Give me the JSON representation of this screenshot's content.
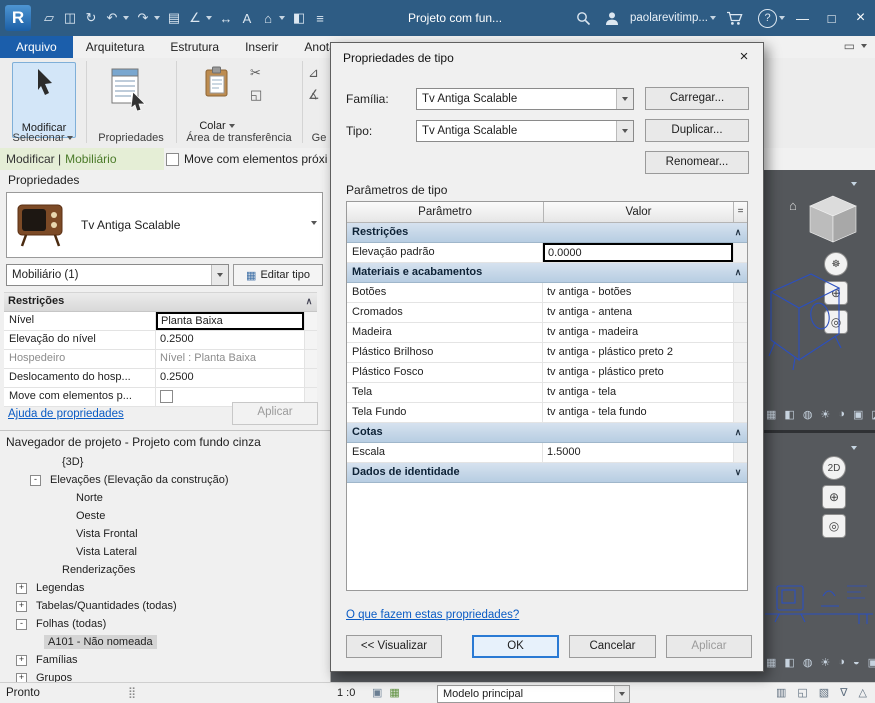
{
  "colors": {
    "titlebar": "#2e5c84",
    "file_tab": "#1b5eab",
    "section_header": "#b7cde2",
    "link": "#0a5bc4",
    "context_green": "#4a7a28",
    "viewport_bg": "#54575b",
    "wireframe_blue": "#2b4fc0"
  },
  "title_bar": {
    "app_button": "R",
    "qat": [
      {
        "name": "open-icon",
        "glyph": "▱"
      },
      {
        "name": "save-icon",
        "glyph": "◫"
      },
      {
        "name": "sync-icon",
        "glyph": "↻"
      },
      {
        "name": "undo-icon",
        "glyph": "↶",
        "caret": true
      },
      {
        "name": "redo-icon",
        "glyph": "↷",
        "caret": true
      },
      {
        "name": "print-icon",
        "glyph": "▤"
      },
      {
        "name": "measure-icon",
        "glyph": "∠",
        "caret": true
      },
      {
        "name": "aligned-dimension-icon",
        "glyph": "↔"
      },
      {
        "name": "text-icon",
        "glyph": "A"
      },
      {
        "name": "default-3d-view-icon",
        "glyph": "⌂",
        "caret": true
      },
      {
        "name": "section-icon",
        "glyph": "◧"
      },
      {
        "name": "thin-lines-icon",
        "glyph": "≡"
      }
    ],
    "project_title": "Projeto com fun...",
    "user_name": "paolarevitimp...",
    "help_glyph": "?",
    "window_controls": {
      "minimize": "—",
      "maximize": "□",
      "close": "×"
    }
  },
  "ribbon": {
    "tabs": [
      {
        "label": "Arquivo",
        "type": "file"
      },
      {
        "label": "Arquitetura"
      },
      {
        "label": "Estrutura"
      },
      {
        "label": "Inserir"
      },
      {
        "label": "Anotar"
      }
    ],
    "corner_icons": [
      {
        "name": "ribbon-display-icon",
        "glyph": "▭"
      }
    ],
    "modify_label": "Modificar",
    "select_panel_label": "Selecionar",
    "properties_panel_label": "Propriedades",
    "paste_label": "Colar",
    "clipboard_panel_label": "Área de transferência",
    "geometry_panel_label": "Ge",
    "clipboard_icons": [
      {
        "name": "cut-icon",
        "glyph": "✂"
      },
      {
        "name": "copy-icon",
        "glyph": "◱"
      }
    ],
    "geometry_icons": [
      {
        "name": "join-geometry-icon",
        "glyph": "⊿"
      },
      {
        "name": "cope-icon",
        "glyph": "∡"
      }
    ]
  },
  "options_bar": {
    "context_prefix": "Modificar |",
    "context_name": "Mobiliário",
    "checkbox_label": "Move com elementos próxim"
  },
  "properties_palette": {
    "title": "Propriedades",
    "type_name": "Tv Antiga Scalable",
    "selector_value": "Mobiliário (1)",
    "edit_type_icon": "▦",
    "edit_type_button": "Editar tipo",
    "rows": [
      {
        "kind": "section",
        "label": "Restrições"
      },
      {
        "kind": "focused",
        "label": "Nível",
        "value": "Planta Baixa"
      },
      {
        "kind": "text",
        "label": "Elevação do nível",
        "value": "0.2500"
      },
      {
        "kind": "readonly",
        "label": "Hospedeiro",
        "value": "Nível : Planta Baixa"
      },
      {
        "kind": "text",
        "label": "Deslocamento do hosp...",
        "value": "0.2500"
      },
      {
        "kind": "checkbox",
        "label": "Move com elementos p...",
        "checked": false
      }
    ],
    "help_link": "Ajuda de propriedades",
    "apply_button": "Aplicar"
  },
  "project_browser": {
    "title": "Navegador de projeto - Projeto com fundo cinza",
    "items": [
      {
        "label": "{3D}",
        "level": 4
      },
      {
        "label": "Elevações (Elevação da construção)",
        "level": 2,
        "expander": "-"
      },
      {
        "label": "Norte",
        "level": 5
      },
      {
        "label": "Oeste",
        "level": 5
      },
      {
        "label": "Vista Frontal",
        "level": 5
      },
      {
        "label": "Vista Lateral",
        "level": 5
      },
      {
        "label": "Renderizações",
        "level": 4
      },
      {
        "label": "Legendas",
        "level": 1,
        "expander": "+"
      },
      {
        "label": "Tabelas/Quantidades (todas)",
        "level": 1,
        "expander": "+"
      },
      {
        "label": "Folhas (todas)",
        "level": 1,
        "expander": "-"
      },
      {
        "label": "A101 - Não nomeada",
        "level": 3,
        "selected": true
      },
      {
        "label": "Famílias",
        "level": 1,
        "expander": "+"
      },
      {
        "label": "Grupos",
        "level": 1,
        "expander": "+"
      }
    ]
  },
  "dialog": {
    "title": "Propriedades de tipo",
    "family_label": "Família:",
    "family_value": "Tv Antiga Scalable",
    "load_button": "Carregar...",
    "type_label": "Tipo:",
    "type_value": "Tv Antiga Scalable",
    "duplicate_button": "Duplicar...",
    "rename_button": "Renomear...",
    "parameters_label": "Parâmetros de tipo",
    "table": {
      "param_header": "Parâmetro",
      "value_header": "Valor",
      "eq_header": "=",
      "rows": [
        {
          "type": "section",
          "label": "Restrições",
          "chevron": "up"
        },
        {
          "type": "value",
          "label": "Elevação padrão",
          "value": "0.0000",
          "focused": true
        },
        {
          "type": "section",
          "label": "Materiais e acabamentos",
          "chevron": "up"
        },
        {
          "type": "value",
          "label": "Botões",
          "value": "tv antiga - botões"
        },
        {
          "type": "value",
          "label": "Cromados",
          "value": "tv antiga - antena"
        },
        {
          "type": "value",
          "label": "Madeira",
          "value": "tv antiga - madeira"
        },
        {
          "type": "value",
          "label": "Plástico Brilhoso",
          "value": "tv antiga - plástico preto 2"
        },
        {
          "type": "value",
          "label": "Plástico Fosco",
          "value": "tv antiga - plástico preto"
        },
        {
          "type": "value",
          "label": "Tela",
          "value": "tv antiga - tela"
        },
        {
          "type": "value",
          "label": "Tela Fundo",
          "value": "tv antiga - tela fundo"
        },
        {
          "type": "section",
          "label": "Cotas",
          "chevron": "up"
        },
        {
          "type": "value",
          "label": "Escala",
          "value": "1.5000"
        },
        {
          "type": "section",
          "label": "Dados de identidade",
          "chevron": "down"
        }
      ]
    },
    "help_link": "O que fazem estas propriedades?",
    "preview_button": "<< Visualizar",
    "ok_button": "OK",
    "cancel_button": "Cancelar",
    "apply_button": "Aplicar"
  },
  "viewport": {
    "home_glyph": "⌂",
    "nav_top": [
      {
        "name": "navigation-wheel-icon",
        "glyph": "☸",
        "round": true
      },
      {
        "name": "zoom-icon",
        "glyph": "⊕"
      },
      {
        "name": "orbit-icon",
        "glyph": "◎"
      }
    ],
    "nav_bottom": [
      {
        "name": "2d-wheel-icon",
        "glyph": "2D",
        "round": true
      },
      {
        "name": "zoom-icon",
        "glyph": "⊕"
      },
      {
        "name": "pan-icon",
        "glyph": "◎"
      }
    ],
    "top_control_icons": [
      {
        "name": "scale-icon",
        "glyph": "▦"
      },
      {
        "name": "detail-level-icon",
        "glyph": "◧"
      },
      {
        "name": "visual-style-icon",
        "glyph": "◍"
      },
      {
        "name": "sun-path-icon",
        "glyph": "☀"
      },
      {
        "name": "shadows-icon",
        "glyph": "◑"
      },
      {
        "name": "crop-view-icon",
        "glyph": "▣"
      },
      {
        "name": "temporary-hide-icon",
        "glyph": "◪"
      },
      {
        "name": "reveal-hidden-icon",
        "glyph": "◉"
      }
    ],
    "bottom_control_icons": [
      {
        "name": "scale-icon",
        "glyph": "▦"
      },
      {
        "name": "detail-level-icon",
        "glyph": "◧"
      },
      {
        "name": "visual-style-icon",
        "glyph": "◍"
      },
      {
        "name": "sun-path-icon",
        "glyph": "☀"
      },
      {
        "name": "shadows-icon",
        "glyph": "◑"
      },
      {
        "name": "rendering-icon",
        "glyph": "◒"
      },
      {
        "name": "crop-view-icon",
        "glyph": "▣"
      },
      {
        "name": "temporary-hide-icon",
        "glyph": "◪"
      },
      {
        "name": "reveal-hidden-icon",
        "glyph": "◉"
      }
    ]
  },
  "status_bar": {
    "ready_label": "Pronto",
    "grip_glyph": "⣿",
    "scale_label": "1 :0",
    "mid_icons": [
      {
        "name": "sheet-icon",
        "glyph": "▣"
      },
      {
        "name": "design-options-icon",
        "glyph": "▦",
        "color": "#5d8f3d"
      }
    ],
    "design_option_value": "Modelo principal",
    "right_icons": [
      {
        "name": "worksets-icon",
        "glyph": "▥"
      },
      {
        "name": "links-icon",
        "glyph": "◱"
      },
      {
        "name": "exclude-options-icon",
        "glyph": "▧"
      },
      {
        "name": "filter-icon",
        "glyph": "∇"
      },
      {
        "name": "selection-toggle-icon",
        "glyph": "△"
      }
    ]
  }
}
